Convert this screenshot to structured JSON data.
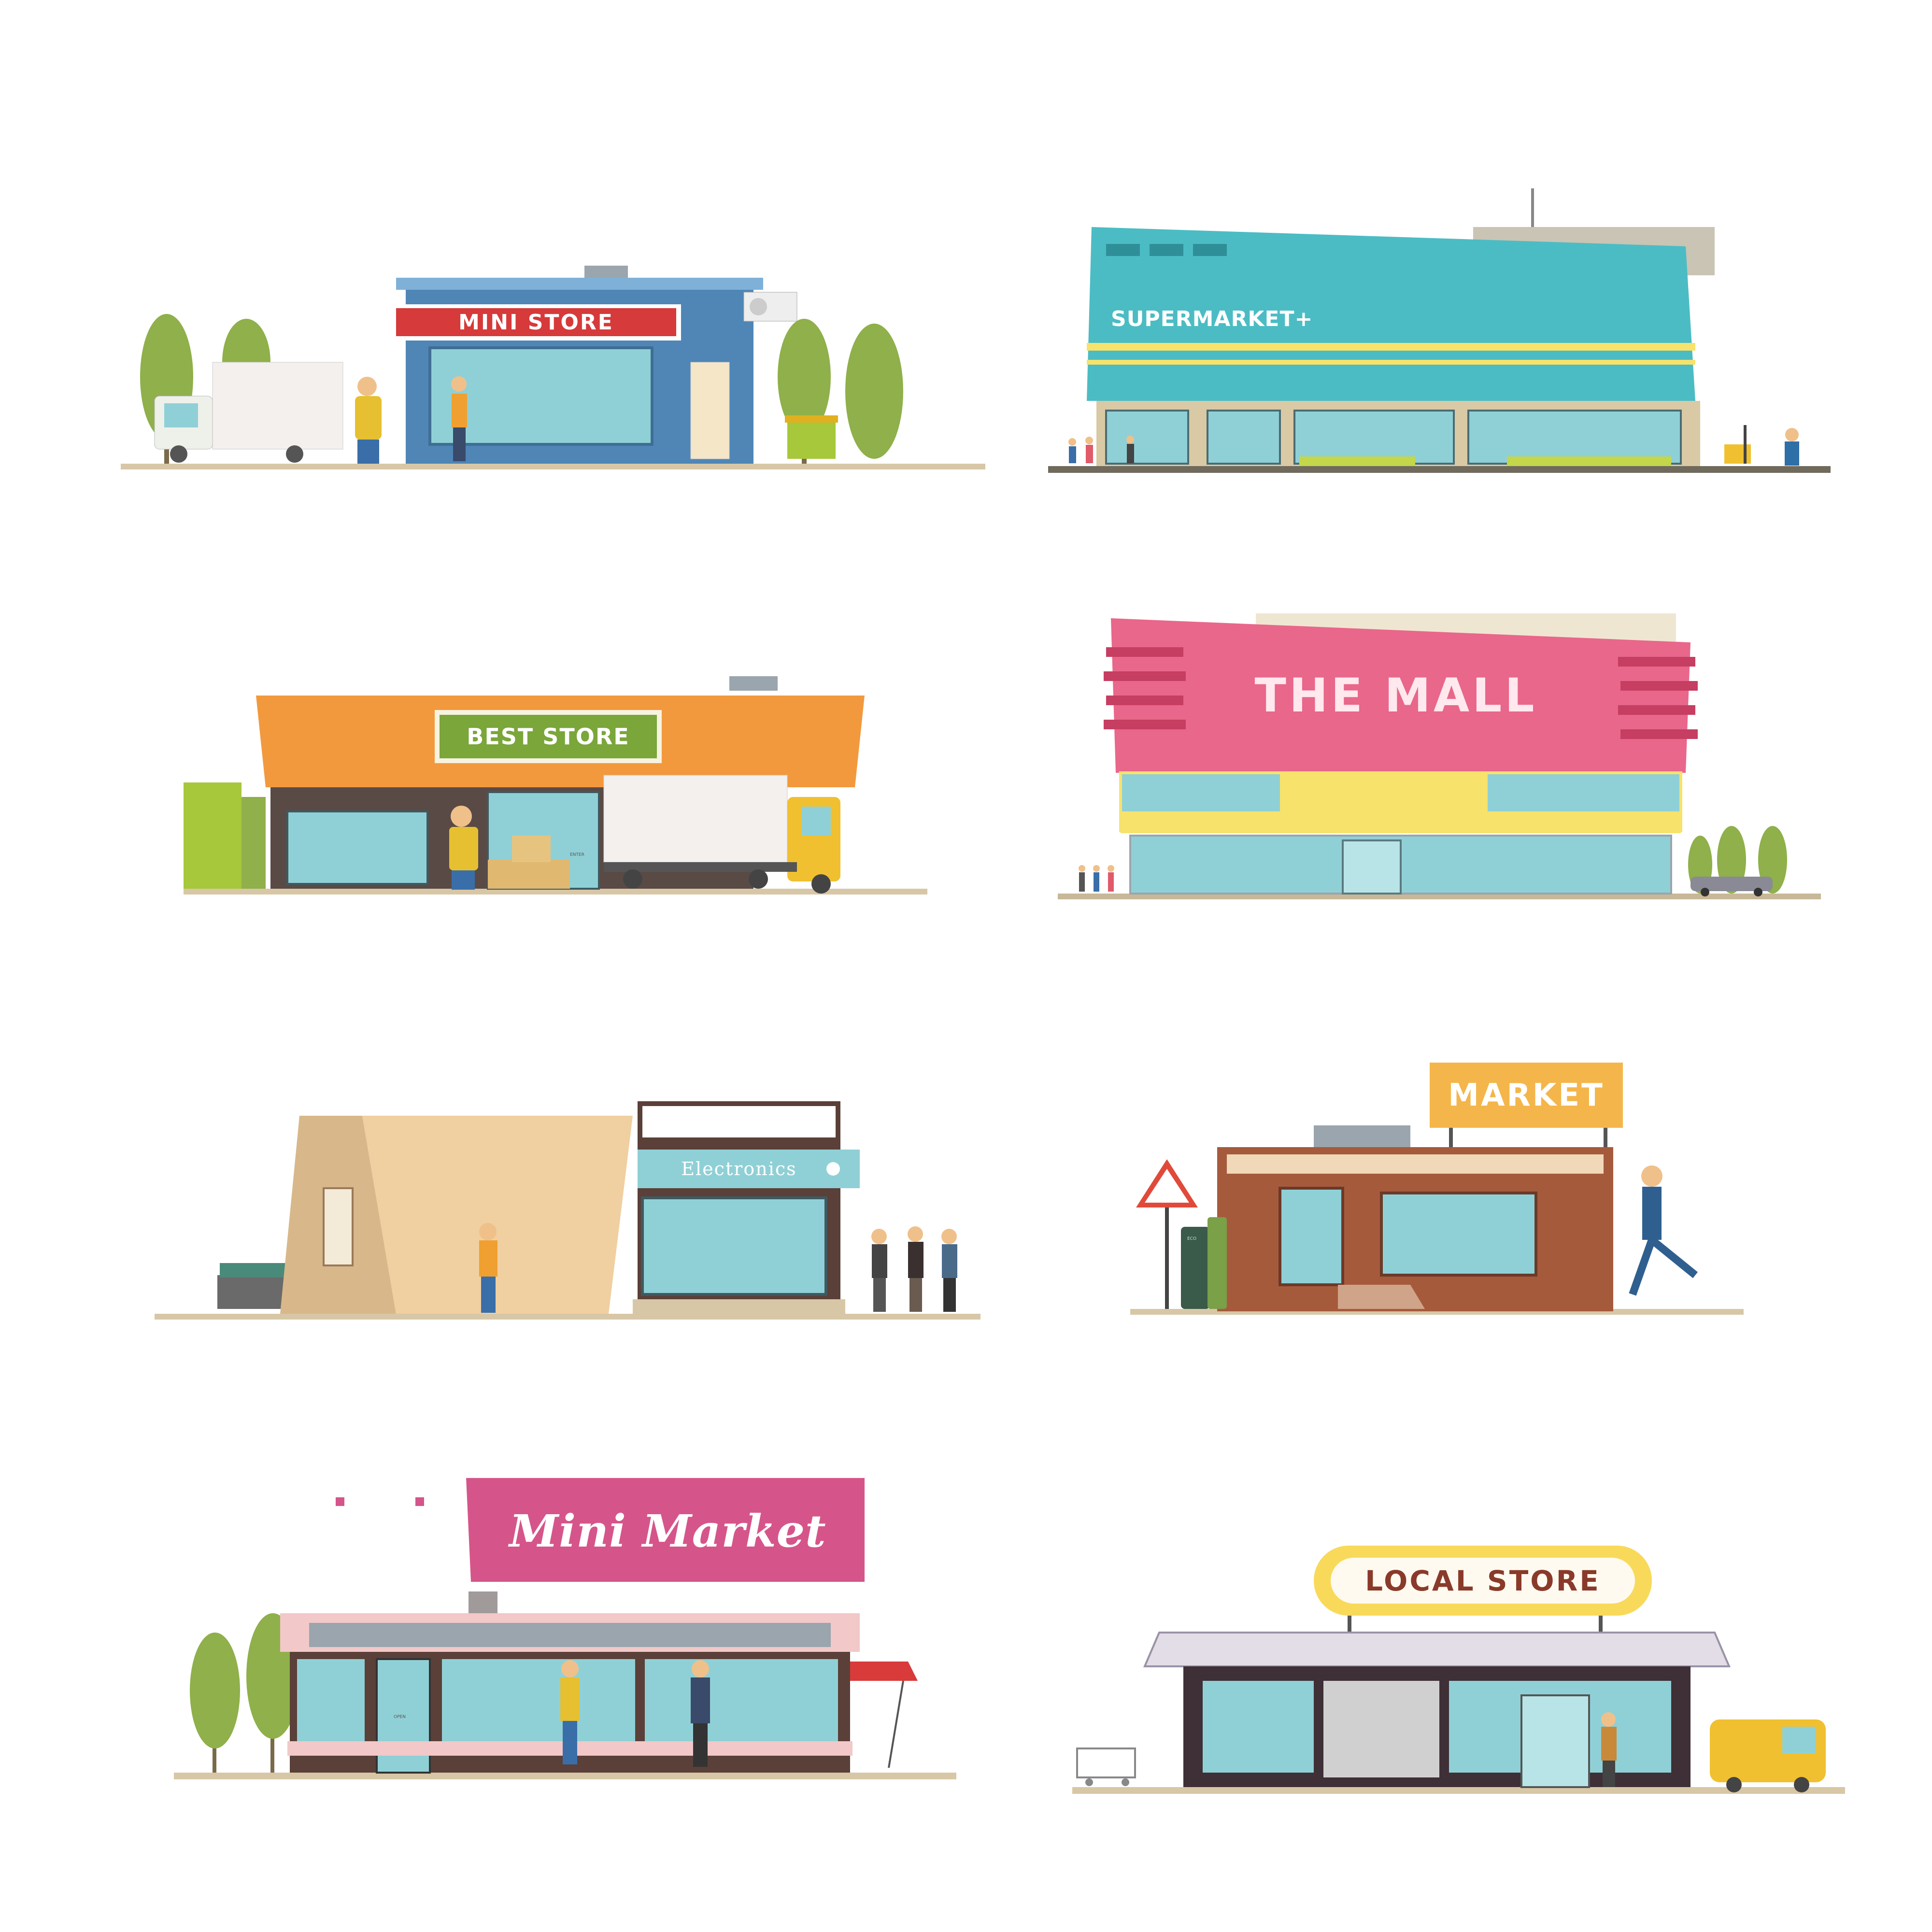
{
  "stores": [
    {
      "id": "mini-store",
      "sign": "MINI STORE"
    },
    {
      "id": "supermarket",
      "sign": "SUPERMARKET+"
    },
    {
      "id": "best-store",
      "sign": "BEST STORE"
    },
    {
      "id": "the-mall",
      "sign": "THE MALL"
    },
    {
      "id": "electronics",
      "sign": "Electronics"
    },
    {
      "id": "market",
      "sign": "MARKET"
    },
    {
      "id": "mini-market",
      "sign": "Mini Market"
    },
    {
      "id": "local-store",
      "sign": "LOCAL STORE"
    }
  ],
  "small_labels": {
    "truck_box": "ENTER",
    "bin": "ECO",
    "door_sign": "OPEN"
  },
  "colors": {
    "ground": "#d8c7a6",
    "tree": "#8fb04a",
    "glass": "#8fd0d6",
    "mini_store_wall": "#4f86b6",
    "mini_store_sign": "#d63a3a",
    "supermarket": "#4bbcc4",
    "best_store": "#f2993e",
    "best_store_sign": "#7aa63a",
    "mall": "#e8678a",
    "mall_band": "#f7e26b",
    "electronics_wall": "#f0cfa0",
    "market_wall": "#a65a3c",
    "market_sign": "#f4b64a",
    "mini_market_sign": "#d5558a",
    "local_store_sign": "#f8d95a"
  }
}
